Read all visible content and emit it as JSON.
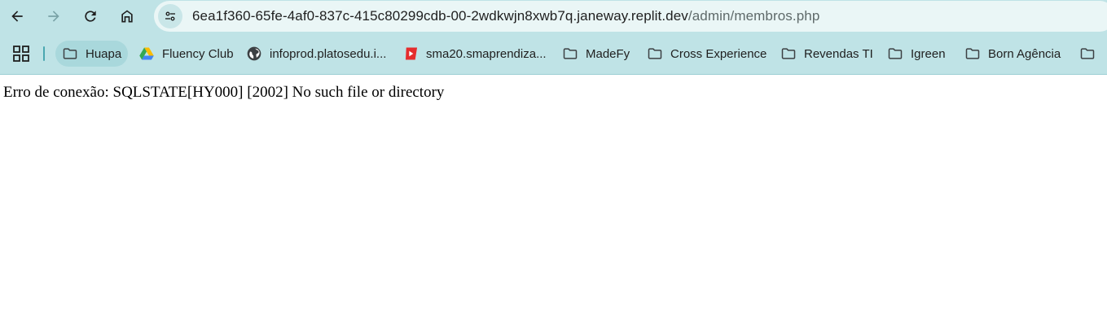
{
  "browser": {
    "nav": {
      "back_icon": "arrow-left-icon",
      "forward_icon": "arrow-right-icon",
      "reload_icon": "reload-icon",
      "home_icon": "home-icon"
    },
    "address_bar": {
      "site_info_icon": "tune-icon",
      "host": "6ea1f360-65fe-4af0-837c-415c80299cdb-00-2wdkwjn8xwb7q.janeway.replit.dev",
      "path": "/admin/membros.php"
    },
    "bookmarks": [
      {
        "label": "Huapa",
        "icon": "folder-icon"
      },
      {
        "label": "Fluency Club",
        "icon": "google-drive-icon"
      },
      {
        "label": "infoprod.platosedu.i...",
        "icon": "globe-icon"
      },
      {
        "label": "sma20.smaprendiza...",
        "icon": "red-play-icon"
      },
      {
        "label": "MadeFy",
        "icon": "folder-icon"
      },
      {
        "label": "Cross Experience",
        "icon": "folder-icon"
      },
      {
        "label": "Revendas TI",
        "icon": "folder-icon"
      },
      {
        "label": "Igreen",
        "icon": "folder-icon"
      },
      {
        "label": "Born Agência",
        "icon": "folder-icon"
      },
      {
        "label": "",
        "icon": "folder-icon"
      }
    ]
  },
  "page": {
    "error_message": "Erro de conexão: SQLSTATE[HY000] [2002] No such file or directory"
  },
  "colors": {
    "chrome_bg": "#bfe3e6",
    "omnibox_bg": "#eaf6f6",
    "accent": "#4aa7b0"
  }
}
